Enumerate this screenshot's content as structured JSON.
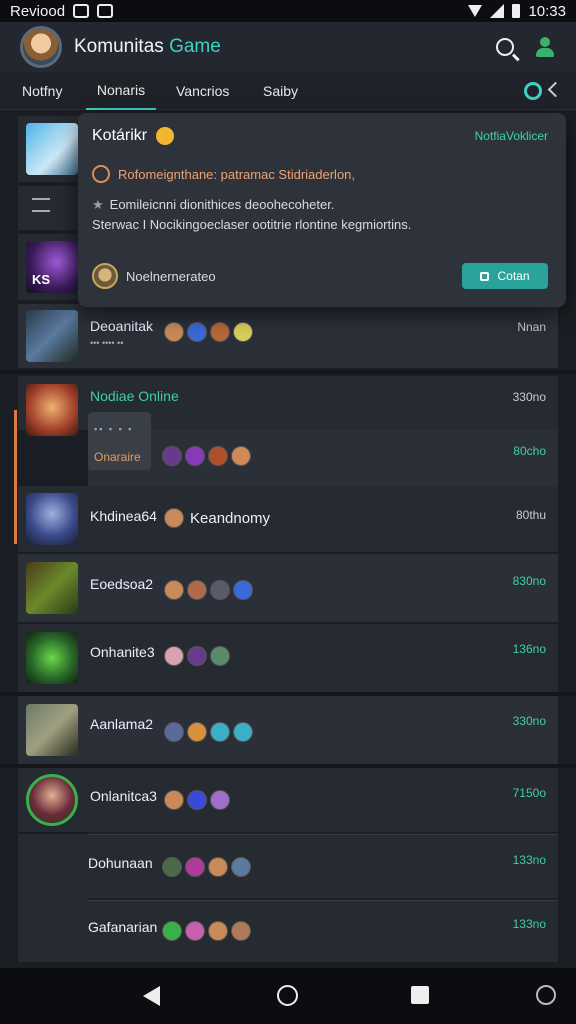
{
  "status_bar": {
    "left_text": "Reviood",
    "time": "10:33"
  },
  "app_bar": {
    "title_main": "Komunitas",
    "title_accent": "Game"
  },
  "tabs": [
    "Notfny",
    "Nonaris",
    "Vancrios",
    "Saiby"
  ],
  "popup": {
    "title": "Kotárikr",
    "link": "NotfiaVoklicer",
    "alert": "Rofomeignthane: patramac Stidriaderlon,",
    "line1": "Eomileicnni dionithices deoohecoheter.",
    "line2": "Sterwac I Nocikingoeclaser ootitrie rlontine kegmiortins.",
    "footer_name": "Noelnernerateo",
    "button_label": "Cotan"
  },
  "rows": [
    {
      "name": "Deoanitak",
      "sub": "••• •••• ••",
      "value": "Nnan"
    },
    {
      "name": "Nodiae Online",
      "value": "330no",
      "sub_value": "80cho",
      "sub_button": "Onaraire",
      "sub_dots": "▪▪ ▪ ▪ ▪"
    },
    {
      "name": "Khdinea64",
      "tag": "Keandnomy",
      "value": "80thu"
    },
    {
      "name": "Eoedsoa2",
      "value": "830no"
    },
    {
      "name": "Onhanite3",
      "value": "136no"
    },
    {
      "name": "Aanlama2",
      "value": "330no"
    },
    {
      "name": "Onlanitca3",
      "value": "7150o"
    },
    {
      "name": "Dohunaan",
      "value": "133no"
    },
    {
      "name": "Gafanarian",
      "value": "133no"
    }
  ],
  "row_partial": {
    "label": "KS"
  },
  "colors": {
    "accent": "#3fd1c2",
    "orange": "#e07a42",
    "green": "#3fd1a2"
  }
}
